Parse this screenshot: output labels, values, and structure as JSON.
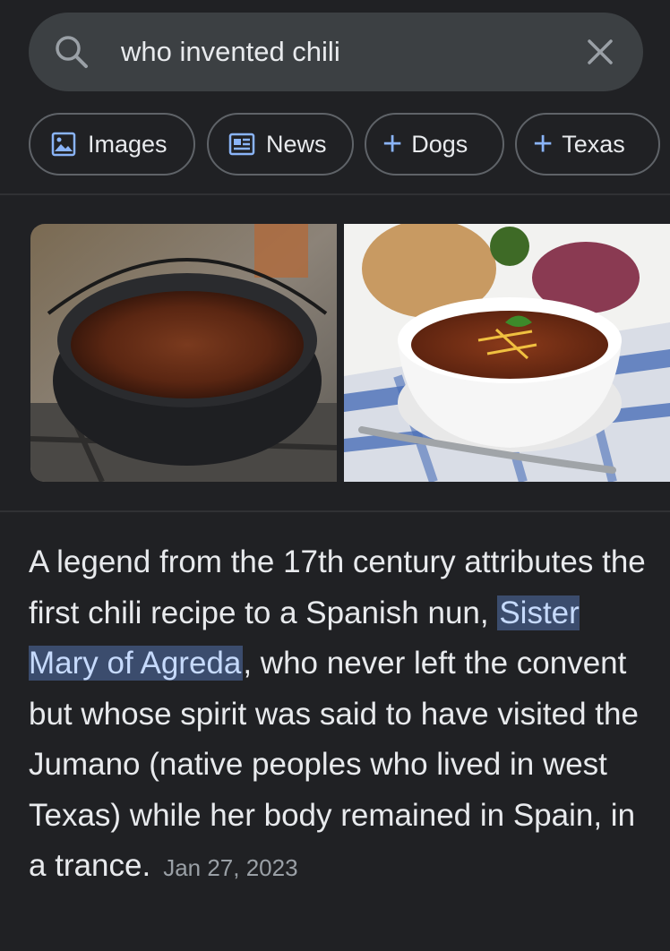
{
  "search": {
    "query": "who invented chili"
  },
  "chips": [
    {
      "label": "Images",
      "icon": "image-icon"
    },
    {
      "label": "News",
      "icon": "news-icon"
    },
    {
      "label": "Dogs",
      "icon": "plus-icon"
    },
    {
      "label": "Texas",
      "icon": "plus-icon"
    }
  ],
  "images": [
    {
      "subject": "chili-pot-photo"
    },
    {
      "subject": "chili-bowl-photo"
    }
  ],
  "answer": {
    "text_before": "A legend from the 17th century attributes the first chili recipe to a Spanish nun, ",
    "highlight": "Sister Mary of Agreda",
    "text_after": ", who never left the convent but whose spirit was said to have visited the Jumano (native peoples who lived in west Texas) while her body remained in Spain, in a trance.",
    "date": "Jan 27, 2023"
  },
  "colors": {
    "background": "#202124",
    "accent": "#8ab4f8",
    "highlight_bg": "#3b4c6d"
  }
}
